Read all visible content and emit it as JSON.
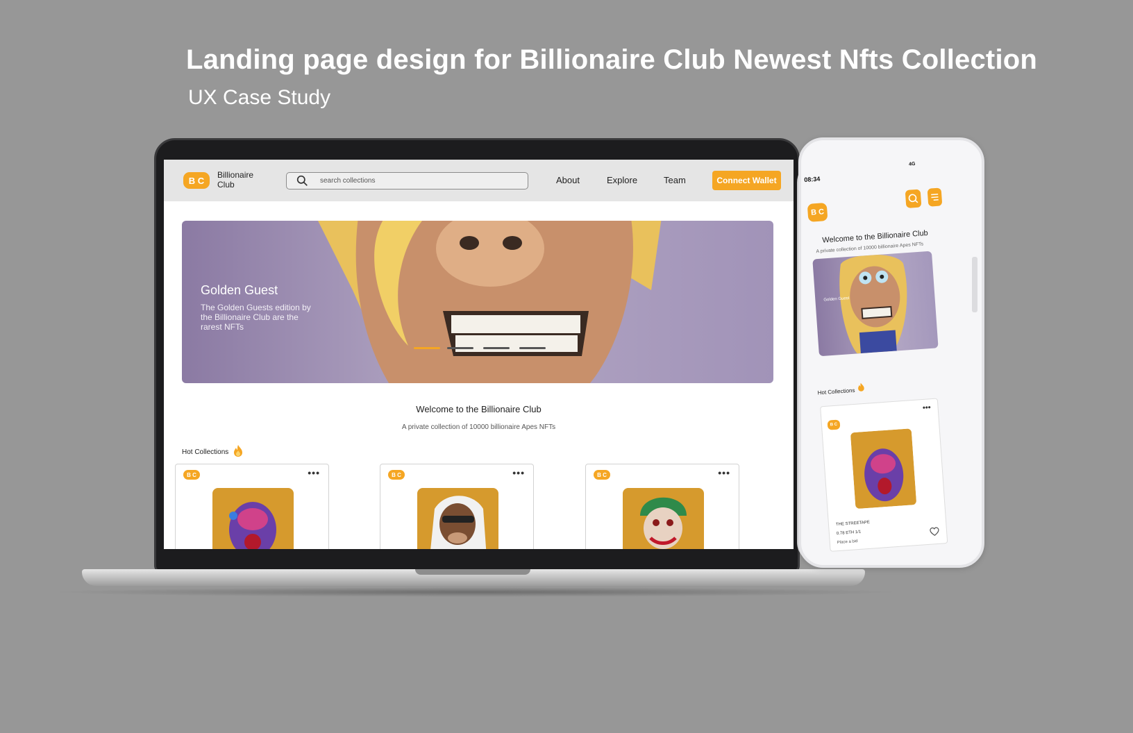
{
  "headline": "Landing page design for Billionaire Club Newest Nfts Collection",
  "subheadline": "UX Case Study",
  "colors": {
    "accent": "#f5a623",
    "background": "#979797",
    "hero_purple": "#9d8fb5"
  },
  "desktop": {
    "nav": {
      "logo_text": "B C",
      "brand_name": "Billionaire Club",
      "search_placeholder": "search collections",
      "links": [
        "About",
        "Explore",
        "Team"
      ],
      "cta": "Connect Wallet"
    },
    "hero": {
      "title": "Golden Guest",
      "description": "The Golden Guests edition by the Billionaire Club are the rarest NFTs"
    },
    "welcome_title": "Welcome to the Billionaire Club",
    "welcome_sub": "A private collection of 10000 billionaire Apes NFTs",
    "hot_collections_label": "Hot Collections",
    "cards": [
      {
        "badge": "B C",
        "menu": "•••"
      },
      {
        "badge": "B C",
        "menu": "•••"
      },
      {
        "badge": "B C",
        "menu": "•••"
      }
    ]
  },
  "mobile": {
    "time": "08:34",
    "network": "4G",
    "logo_text": "B C",
    "welcome_title": "Welcome to the Billionaire Club",
    "welcome_sub": "A private collection of 10000 billionaire Apes NFTs",
    "hot_collections_label": "Hot Collections",
    "card": {
      "badge": "B C",
      "menu": "•••",
      "name": "THE STREETAPE",
      "price": "0.78 ETH  1/1",
      "action": "Place a bid"
    }
  }
}
